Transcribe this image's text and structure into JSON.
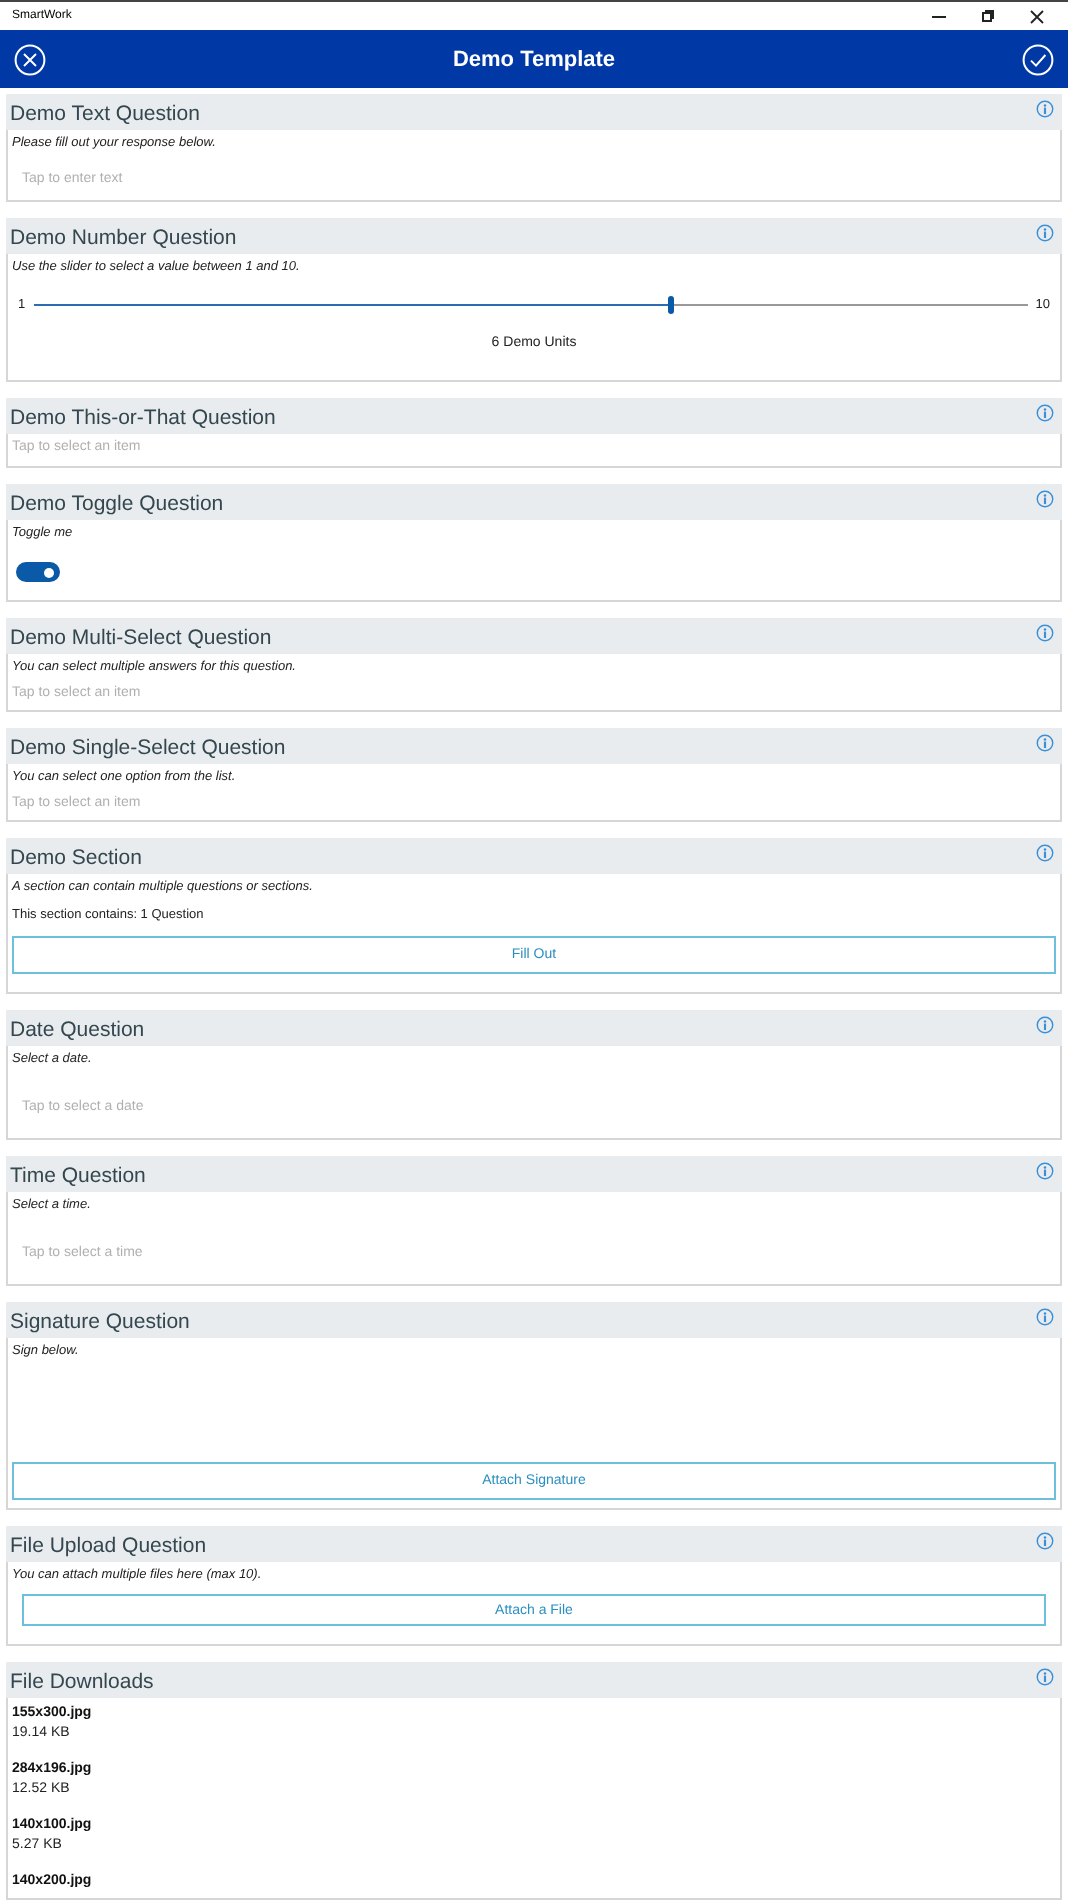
{
  "window": {
    "title": "SmartWork"
  },
  "header": {
    "title": "Demo Template"
  },
  "questions": [
    {
      "kind": "text",
      "title": "Demo Text Question",
      "description": "Please fill out your response below.",
      "placeholder": "Tap to enter text"
    },
    {
      "kind": "number",
      "title": "Demo Number Question",
      "description": "Use the slider to select a value between 1 and 10.",
      "min_label": "1",
      "max_label": "10",
      "level": 0.64,
      "reading": "6 Demo Units"
    },
    {
      "kind": "choice",
      "title": "Demo This-or-That Question",
      "placeholder": "Tap to select an item"
    },
    {
      "kind": "toggle",
      "title": "Demo Toggle Question",
      "description": "Toggle me",
      "on": true
    },
    {
      "kind": "choice",
      "title": "Demo Multi-Select Question",
      "description": "You can select multiple answers for this question.",
      "placeholder": "Tap to select an item"
    },
    {
      "kind": "choice",
      "title": "Demo Single-Select Question",
      "description": "You can select one option from the list.",
      "placeholder": "Tap to select an item"
    },
    {
      "kind": "section",
      "title": "Demo Section",
      "description": "A section can contain multiple questions or sections.",
      "summary": "This section contains: 1 Question",
      "button": "Fill Out"
    },
    {
      "kind": "date",
      "title": "Date Question",
      "description": "Select a date.",
      "placeholder": "Tap to select a date"
    },
    {
      "kind": "date",
      "title": "Time Question",
      "description": "Select a time.",
      "placeholder": "Tap to select a time"
    },
    {
      "kind": "signature",
      "title": "Signature Question",
      "description": "Sign below.",
      "button": "Attach Signature"
    },
    {
      "kind": "upload",
      "title": "File Upload Question",
      "description": "You can attach multiple files here (max 10).",
      "button": "Attach a File"
    },
    {
      "kind": "downloads",
      "title": "File Downloads",
      "files": [
        {
          "name": "155x300.jpg",
          "size": "19.14 KB"
        },
        {
          "name": "284x196.jpg",
          "size": "12.52 KB"
        },
        {
          "name": "140x100.jpg",
          "size": "5.27 KB"
        },
        {
          "name": "140x200.jpg"
        }
      ]
    }
  ]
}
